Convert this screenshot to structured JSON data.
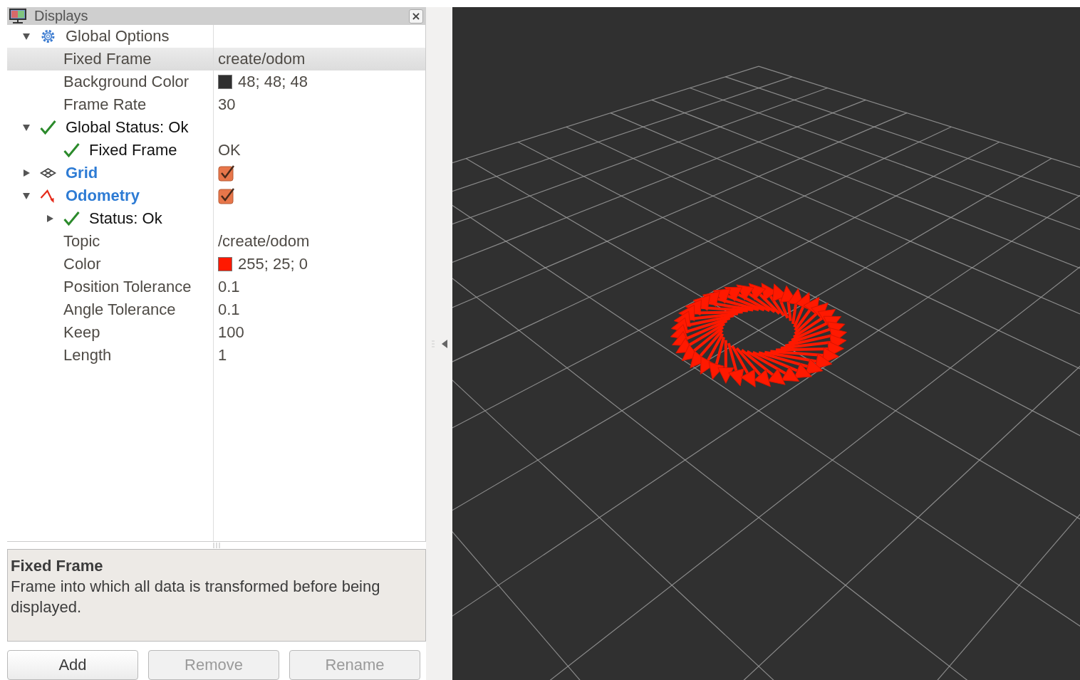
{
  "panel": {
    "title": "Displays",
    "close_label": "×"
  },
  "tree": [
    {
      "kind": "options",
      "label": "Global Options",
      "expanded": true,
      "selected": false,
      "children": [
        {
          "kind": "property",
          "label": "Fixed Frame",
          "value": "create/odom",
          "selected": true
        },
        {
          "kind": "property",
          "label": "Background Color",
          "value": "48; 48; 48",
          "color": "#303030",
          "selected": false
        },
        {
          "kind": "property",
          "label": "Frame Rate",
          "value": "30",
          "selected": false
        }
      ]
    },
    {
      "kind": "status",
      "label": "Global Status: Ok",
      "expanded": true,
      "selected": false,
      "children": [
        {
          "kind": "status",
          "label": "Fixed Frame",
          "value": "OK",
          "selected": false
        }
      ]
    },
    {
      "kind": "grid-display",
      "label": "Grid",
      "checked": true,
      "expanded": false,
      "selected": false
    },
    {
      "kind": "odometry-display",
      "label": "Odometry",
      "checked": true,
      "expanded": true,
      "selected": false,
      "children": [
        {
          "kind": "status",
          "label": "Status: Ok",
          "expanded": false,
          "selected": false
        },
        {
          "kind": "property",
          "label": "Topic",
          "value": "/create/odom",
          "selected": false
        },
        {
          "kind": "property",
          "label": "Color",
          "value": "255; 25; 0",
          "color": "#ff1900",
          "selected": false
        },
        {
          "kind": "property",
          "label": "Position Tolerance",
          "value": "0.1",
          "selected": false
        },
        {
          "kind": "property",
          "label": "Angle Tolerance",
          "value": "0.1",
          "selected": false
        },
        {
          "kind": "property",
          "label": "Keep",
          "value": "100",
          "selected": false
        },
        {
          "kind": "property",
          "label": "Length",
          "value": "1",
          "selected": false
        }
      ]
    }
  ],
  "description": {
    "title": "Fixed Frame",
    "text": "Frame into which all data is transformed before being displayed."
  },
  "buttons": [
    {
      "label": "Add",
      "disabled": false
    },
    {
      "label": "Remove",
      "disabled": true
    },
    {
      "label": "Rename",
      "disabled": true
    }
  ]
}
